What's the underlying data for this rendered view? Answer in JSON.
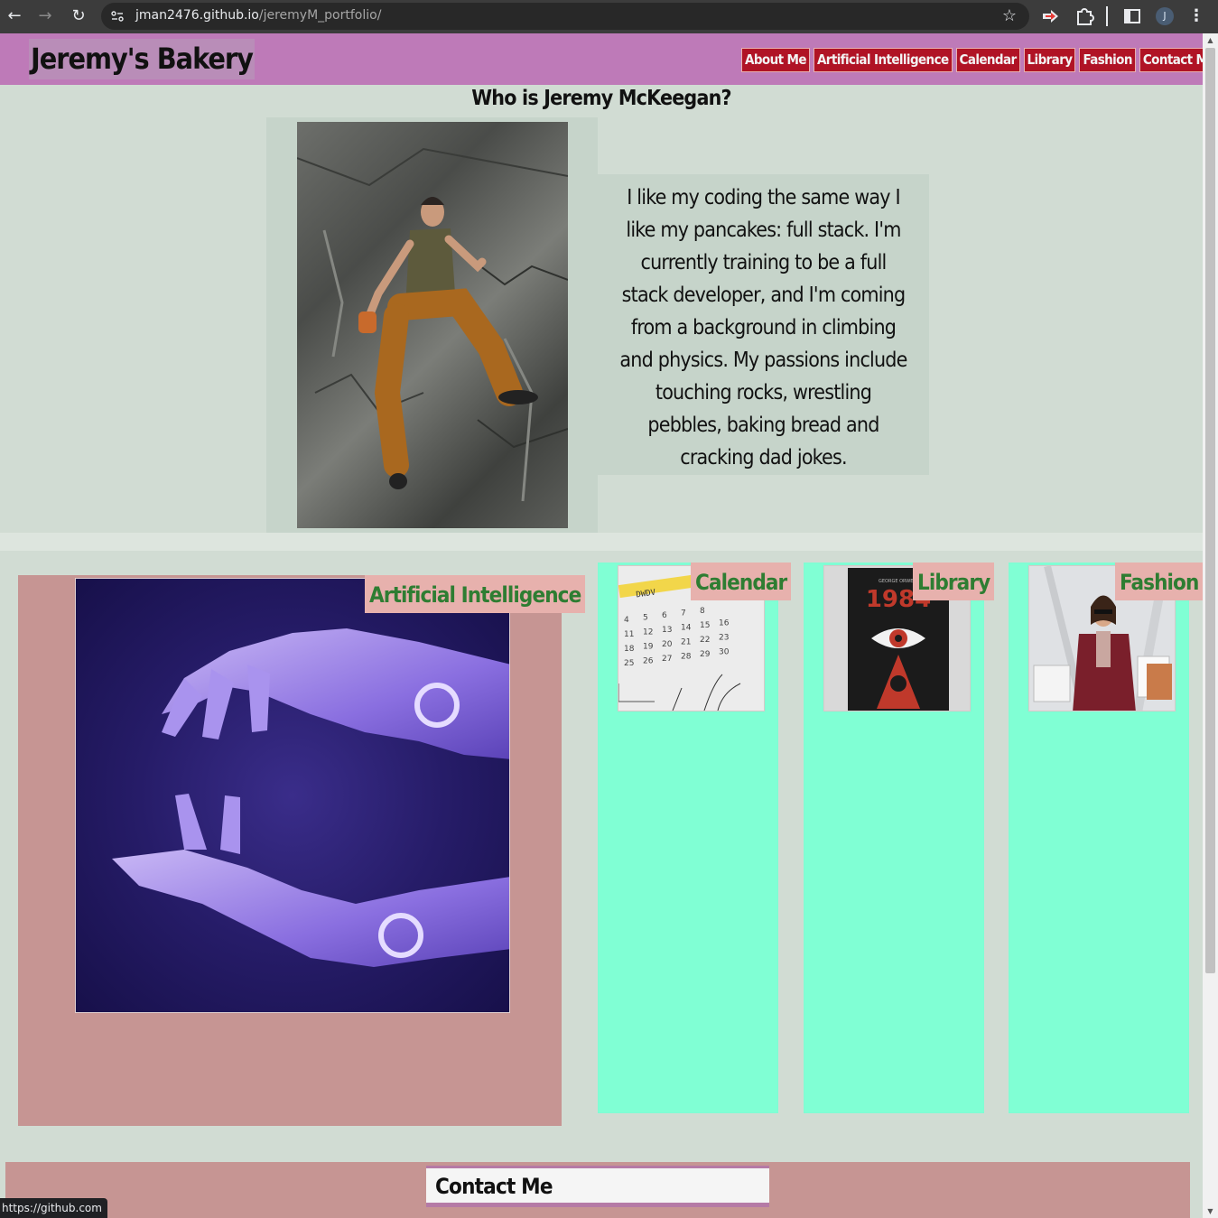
{
  "browser": {
    "url_host": "jman2476.github.io",
    "url_path": "/jeremyM_portfolio/",
    "profile_initial": "J"
  },
  "site": {
    "brand": "Jeremy's Bakery",
    "nav": [
      "About Me",
      "Artificial Intelligence",
      "Calendar",
      "Library",
      "Fashion",
      "Contact Me"
    ]
  },
  "about": {
    "title": "Who is Jeremy McKeegan?",
    "bio": "I like my coding the same way I like my pancakes: full stack. I'm currently training to be a full stack developer, and I'm coming from a background in climbing and physics. My passions include touching rocks, wrestling pebbles, baking bread and cracking dad jokes."
  },
  "projects": {
    "ai_label": "Artificial Intelligence",
    "calendar_label": "Calendar",
    "library_label": "Library",
    "fashion_label": "Fashion",
    "calendar_days": [
      "4",
      "5",
      "6",
      "7",
      "8",
      "11",
      "12",
      "13",
      "14",
      "15",
      "16",
      "18",
      "19",
      "20",
      "21",
      "22",
      "23",
      "25",
      "26",
      "27",
      "28",
      "29",
      "30"
    ],
    "calendar_weekdays": "DWDV",
    "library_book": {
      "author": "GEORGE ORWELL",
      "title": "1984"
    }
  },
  "contact": {
    "title": "Contact Me"
  },
  "status_tooltip": "https://github.com",
  "colors": {
    "header_bg": "#be7ab8",
    "nav_bg": "#b01325",
    "page_bg": "#d1dcd3",
    "card_rose": "#c69593",
    "card_mint": "#80ffd4",
    "label_green": "#2e7d32"
  }
}
